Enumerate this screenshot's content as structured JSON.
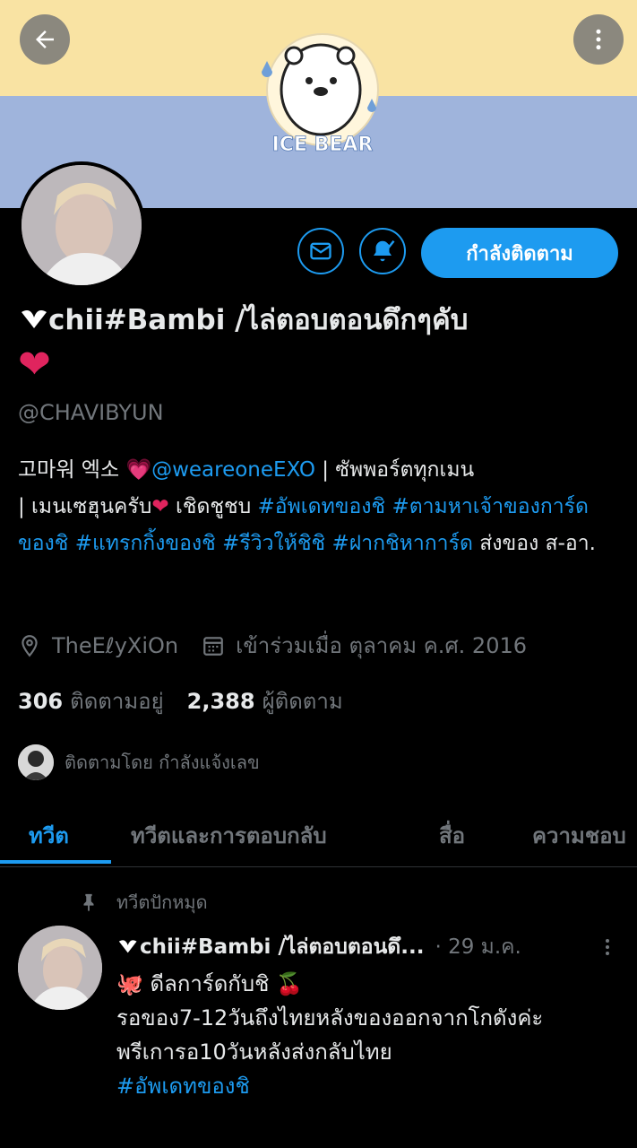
{
  "banner": {
    "character_text": "ICE BEAR",
    "colors": {
      "top": "#f9e3a3",
      "bottom": "#9fb4dc"
    }
  },
  "nav": {
    "back_icon": "arrow-left-icon",
    "more_icon": "more-vertical-icon"
  },
  "profile": {
    "name": "chii#Bambi /ไล่ตอบตอนดึกๆคับ",
    "handle": "@CHAVIBYUN",
    "bio": {
      "line1_prefix": "고마워 엑소 ",
      "mention": "@weareoneEXO",
      "line1_suffix": " | ซัพพอร์ตทุกเมน",
      "line2_prefix": "| เมนเซฮุนครับ",
      "line2_mid": " เชิดชูชบ ",
      "tag1": "#อัพเดทของชิ",
      "tag2": "#ตามหาเจ้าของการ์ดของชิ",
      "tag3": "#แทรกกิ้งของชิ",
      "tag4": "#รีวิวให้ชิชิ",
      "tag5": "#ฝากชิหาการ์ด",
      "line_end": " ส่งของ ส-อา."
    },
    "location": "TheEℓyXiOn",
    "joined": "เข้าร่วมเมื่อ ตุลาคม ค.ศ. 2016",
    "following_count": "306",
    "following_label": "ติดตามอยู่",
    "followers_count": "2,388",
    "followers_label": "ผู้ติดตาม",
    "followed_by": "ติดตามโดย กำลังแจ้งเลข"
  },
  "actions": {
    "following_button": "กำลังติดตาม",
    "accent": "#1d9bf0"
  },
  "tabs": [
    {
      "label": "ทวีต",
      "active": true
    },
    {
      "label": "ทวีตและการตอบกลับ",
      "active": false
    },
    {
      "label": "สื่อ",
      "active": false
    },
    {
      "label": "ความชอบ",
      "active": false
    }
  ],
  "pinned": {
    "label": "ทวีตปักหมุด",
    "tweet": {
      "name": "chii#Bambi /ไล่ตอบตอนดึ...",
      "date": "· 29 ม.ค.",
      "line1": " ดีลการ์ดกับชิ ",
      "line2": "รอของ7-12วันถึงไทยหลังของออกจากโกดังค่ะ",
      "line3": "พรีเการอ10วันหลังส่งกลับไทย",
      "tag": "#อัพเดทของชิ"
    }
  }
}
